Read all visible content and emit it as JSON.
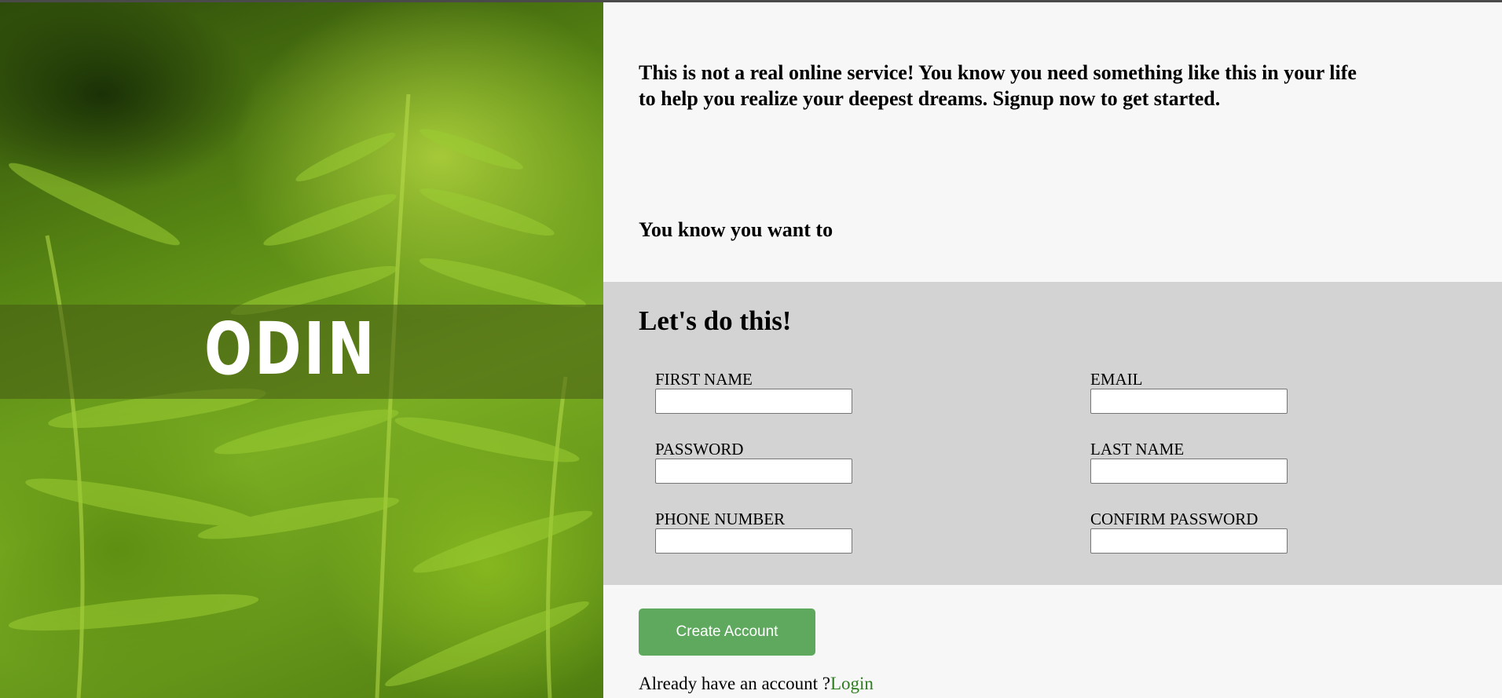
{
  "hero": {
    "logo_text": "ODIN",
    "logo_icon": "viking-helmet-icon"
  },
  "intro": {
    "text": "This is not a real online service! You know you need something like this in your life to help you realize your deepest dreams. Signup now to get started.",
    "tagline": "You know you want to"
  },
  "form": {
    "title": "Let's do this!",
    "fields": [
      {
        "label": "FIRST NAME",
        "value": ""
      },
      {
        "label": "EMAIL",
        "value": ""
      },
      {
        "label": "PASSWORD",
        "value": ""
      },
      {
        "label": "LAST NAME",
        "value": ""
      },
      {
        "label": "PHONE NUMBER",
        "value": ""
      },
      {
        "label": "CONFIRM PASSWORD",
        "value": ""
      }
    ]
  },
  "actions": {
    "create_label": "Create Account",
    "login_prompt": "Already have an account ?",
    "login_link": "Login"
  },
  "colors": {
    "page_bg": "#f7f7f7",
    "form_bg": "#d3d3d3",
    "button_bg": "#5fa95f",
    "link": "#2e7d1f"
  }
}
